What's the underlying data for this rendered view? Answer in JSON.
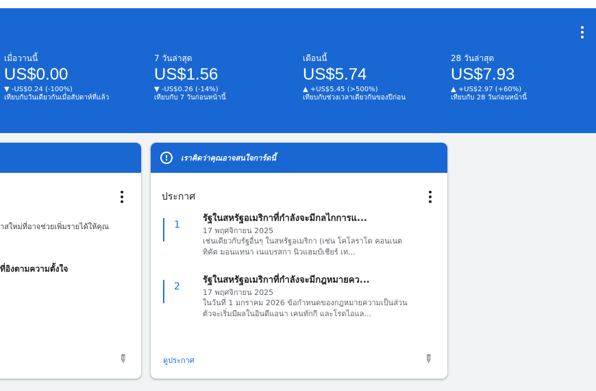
{
  "banner": {
    "stats": [
      {
        "label": "เมื่อวานนี้",
        "value": "US$0.00",
        "change": "▼ -US$0.24 (-100%)",
        "compare": "เทียบกับวันเดียวกันเมื่อสัปดาห์ที่แล้ว"
      },
      {
        "label": "7 วันล่าสุด",
        "value": "US$1.56",
        "change": "▼ -US$0.26 (-14%)",
        "compare": "เทียบกับ 7 วันก่อนหน้านี้"
      },
      {
        "label": "เดือนนี้",
        "value": "US$5.74",
        "change": "▲ +US$5.45 (>500%)",
        "compare": "เทียบกับช่วงเวลาเดียวกันของปีก่อน"
      },
      {
        "label": "28 วันล่าสุด",
        "value": "US$7.93",
        "change": "▲ +US$2.97 (+60%)",
        "compare": "เทียบกับ 28 วันก่อนหน้านี้"
      }
    ],
    "icons": {
      "menu": "more-vert-icon"
    }
  },
  "left_card": {
    "text1": "าสใหม่ที่อาจช่วยเพิ่มรายได้ให้คุณ",
    "text2": "ที่อิงตามความตั้งใจ",
    "icons": {
      "menu": "more-vert-icon",
      "pin": "pin-icon"
    }
  },
  "right_card": {
    "header": "เราคิดว่าคุณอาจสนใจการ์ดนี้",
    "section_title": "ประกาศ",
    "announcements": [
      {
        "number": "1",
        "title": "รัฐในสหรัฐอเมริกาที่กำลังจะมีกลไกการแ...",
        "date": "17 พฤศจิกายน 2025",
        "desc1": "เช่นเดียวกับรัฐอื่นๆ ในสหรัฐอเมริกา (เช่น โคโลราโด คอนเนต",
        "desc2": "ทิคัต มอนแทนา เนแบรสกา นิวแฮมป์เชียร์ เท..."
      },
      {
        "number": "2",
        "title": "รัฐในสหรัฐอเมริกาที่กำลังจะมีกฎหมายคว...",
        "date": "17 พฤศจิกายน 2025",
        "desc1": "ในวันที่ 1 มกราคม 2026 ข้อกำหนดของกฎหมายความเป็นส่วน",
        "desc2": "ตัวจะเริ่มมีผลในอินดีแอนา เคนทักกี และโรดไอแล..."
      }
    ],
    "view_link": "ดูประกาศ",
    "icons": {
      "header": "alert-circle-icon",
      "menu": "more-vert-icon",
      "pin": "pin-icon"
    }
  },
  "colors": {
    "accent": "#1967d2",
    "link": "#1a73e8",
    "background": "#f1f3f4"
  }
}
